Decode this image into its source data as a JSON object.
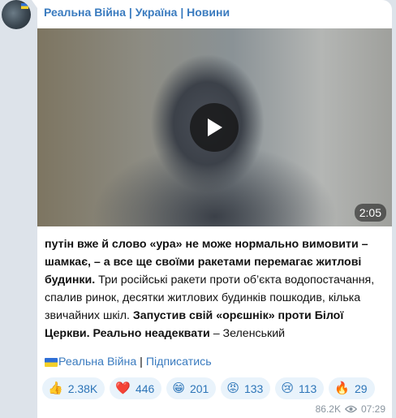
{
  "channel": {
    "name": "Реальна Війна | Україна | Новини"
  },
  "video": {
    "duration": "2:05"
  },
  "message": {
    "p1_bold": "путін вже й слово «ура» не може нормально вимовити – шамкає, – а все ще своїми ракетами перемагає житлові будинки.",
    "p1_rest": " Три російські ракети проти об’єкта водопостачання, спалив ринок, десятки житлових будинків пошкодив, кілька звичайних шкіл.",
    "p2_bold": " Запустив свій «орєшнік» проти Білої Церкви. Реально неадеквати",
    "p2_rest": " – Зеленський"
  },
  "footer": {
    "channel_link": "Реальна Війна",
    "separator": " | ",
    "subscribe_link": "Підписатись"
  },
  "reactions": [
    {
      "emoji": "👍",
      "icon": "thumbs-up-icon",
      "count": "2.38K"
    },
    {
      "emoji": "❤️",
      "icon": "heart-icon",
      "count": "446"
    },
    {
      "emoji": "😁",
      "icon": "grin-icon",
      "count": "201"
    },
    {
      "emoji": "😡",
      "icon": "angry-face-icon",
      "count": "133"
    },
    {
      "emoji": "😢",
      "icon": "crying-face-icon",
      "count": "113"
    },
    {
      "emoji": "🔥",
      "icon": "fire-icon",
      "count": "29"
    }
  ],
  "meta": {
    "views": "86.2K",
    "time": "07:29"
  },
  "colors": {
    "link": "#3a7bbf",
    "reaction_bg": "#e9f3fb",
    "chat_bg": "#dde3ea"
  }
}
